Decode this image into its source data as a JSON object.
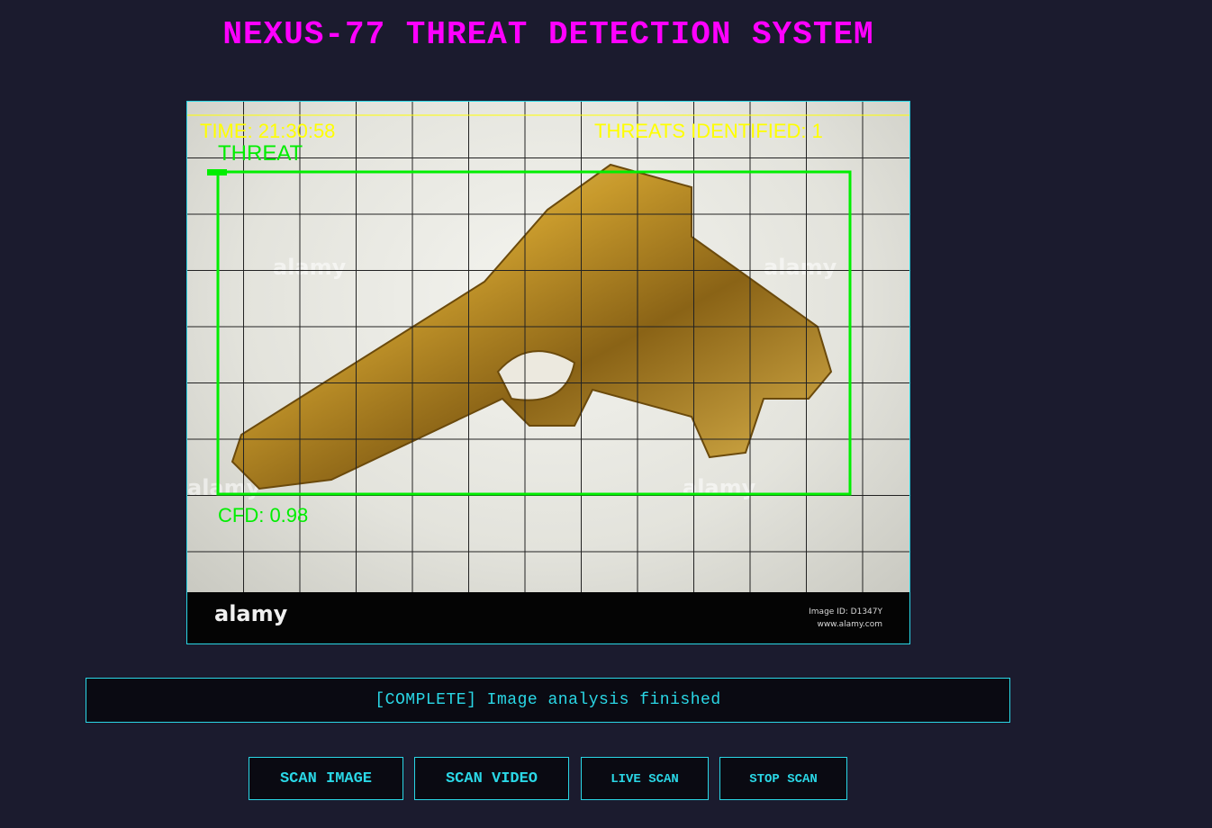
{
  "app": {
    "title": "NEXUS-77 THREAT DETECTION SYSTEM"
  },
  "feed": {
    "time_label": "TIME: 21:30:58",
    "threats_label": "THREATS IDENTIFIED: 1",
    "detection": {
      "label": "THREAT",
      "confidence_label": "CFD: 0.98",
      "confidence": 0.98
    },
    "watermark_text": "alamy",
    "footer_logo": "alamy",
    "footer_image_id": "Image ID: D1347Y",
    "footer_url": "www.alamy.com",
    "grid_overlay": true,
    "colors": {
      "hud": "#ffff00",
      "detection": "#00ee00",
      "grid": "#222222"
    }
  },
  "status": {
    "message": "[COMPLETE] Image analysis finished"
  },
  "controls": {
    "scan_image_label": "SCAN IMAGE",
    "scan_video_label": "SCAN VIDEO",
    "live_scan_label": "LIVE SCAN",
    "stop_scan_label": "STOP SCAN"
  },
  "theme": {
    "background": "#1b1b2e",
    "title_color": "#ff00ff",
    "accent": "#2ad7e6"
  }
}
